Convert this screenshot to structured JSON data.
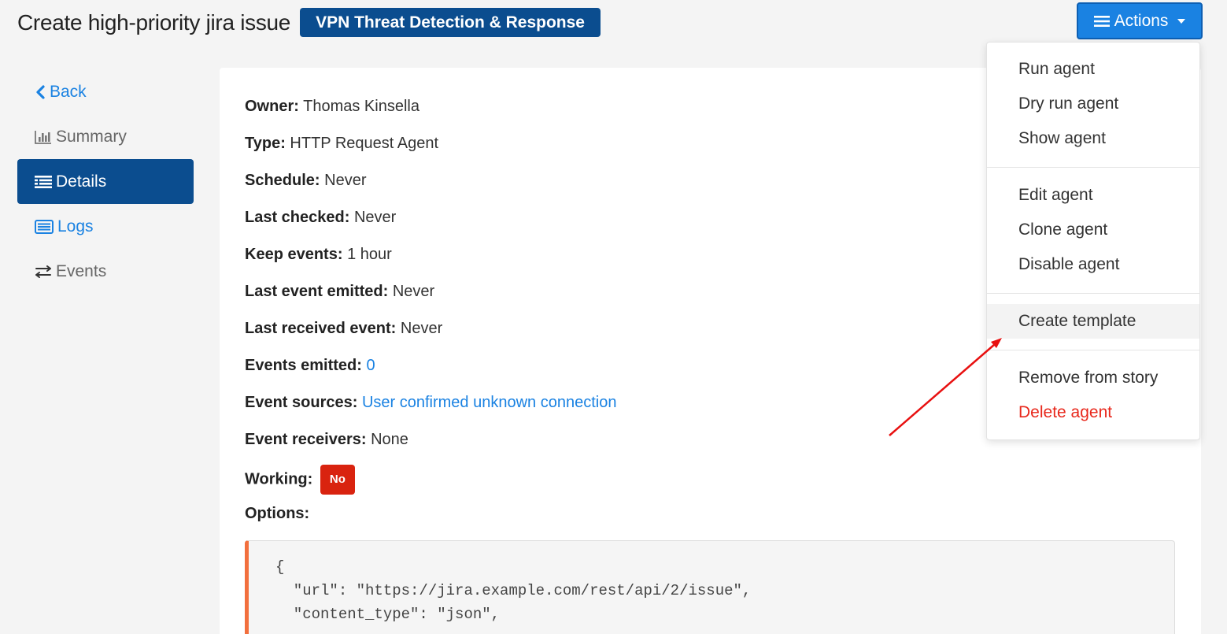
{
  "header": {
    "title": "Create high-priority jira issue",
    "story_badge": "VPN Threat Detection & Response",
    "actions_label": "Actions"
  },
  "sidebar": {
    "items": [
      {
        "label": "Back",
        "icon": "chevron-left-icon"
      },
      {
        "label": "Summary",
        "icon": "bar-chart-icon"
      },
      {
        "label": "Details",
        "icon": "list-icon"
      },
      {
        "label": "Logs",
        "icon": "logs-icon"
      },
      {
        "label": "Events",
        "icon": "exchange-icon"
      }
    ]
  },
  "details": {
    "owner_label": "Owner:",
    "owner": "Thomas Kinsella",
    "type_label": "Type:",
    "type": "HTTP Request Agent",
    "schedule_label": "Schedule:",
    "schedule": "Never",
    "last_checked_label": "Last checked:",
    "last_checked": "Never",
    "keep_events_label": "Keep events:",
    "keep_events": "1 hour",
    "last_event_emitted_label": "Last event emitted:",
    "last_event_emitted": "Never",
    "last_received_event_label": "Last received event:",
    "last_received_event": "Never",
    "events_emitted_label": "Events emitted:",
    "events_emitted": "0",
    "event_sources_label": "Event sources:",
    "event_sources": "User confirmed unknown connection",
    "event_receivers_label": "Event receivers:",
    "event_receivers": "None",
    "working_label": "Working:",
    "working": "No",
    "options_label": "Options:"
  },
  "options_code": {
    "line1": "{",
    "line2": "  \"url\": \"https://jira.example.com/rest/api/2/issue\",",
    "line3": "  \"content_type\": \"json\","
  },
  "actions_menu": {
    "run": "Run agent",
    "dry_run": "Dry run agent",
    "show": "Show agent",
    "edit": "Edit agent",
    "clone": "Clone agent",
    "disable": "Disable agent",
    "create_template": "Create template",
    "remove_from_story": "Remove from story",
    "delete": "Delete agent"
  },
  "colors": {
    "primary": "#1a82e2",
    "nav_active": "#0b4d8f",
    "danger": "#e8281c",
    "code_accent": "#f26f3d",
    "annotation_arrow": "#e81010"
  }
}
